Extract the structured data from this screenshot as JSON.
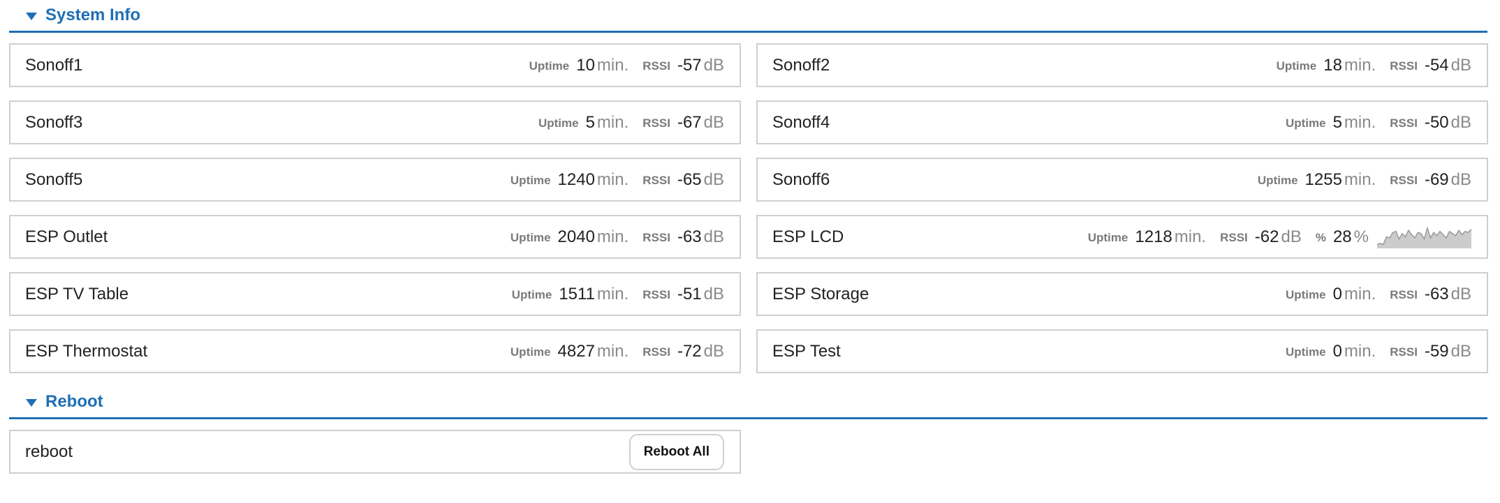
{
  "system_info": {
    "title": "System Info",
    "labels": {
      "uptime": "Uptime",
      "rssi": "RSSI",
      "percent": "%"
    },
    "units": {
      "uptime": "min.",
      "rssi": "dB",
      "percent": "%"
    },
    "devices": [
      {
        "name": "Sonoff1",
        "uptime": "10",
        "rssi": "-57"
      },
      {
        "name": "Sonoff2",
        "uptime": "18",
        "rssi": "-54"
      },
      {
        "name": "Sonoff3",
        "uptime": "5",
        "rssi": "-67"
      },
      {
        "name": "Sonoff4",
        "uptime": "5",
        "rssi": "-50"
      },
      {
        "name": "Sonoff5",
        "uptime": "1240",
        "rssi": "-65"
      },
      {
        "name": "Sonoff6",
        "uptime": "1255",
        "rssi": "-69"
      },
      {
        "name": "ESP Outlet",
        "uptime": "2040",
        "rssi": "-63"
      },
      {
        "name": "ESP LCD",
        "uptime": "1218",
        "rssi": "-62",
        "percent": "28",
        "sparkline": [
          3,
          4,
          3,
          10,
          9,
          14,
          15,
          8,
          13,
          10,
          16,
          12,
          9,
          14,
          13,
          8,
          18,
          9,
          14,
          11,
          15,
          12,
          9,
          15,
          13,
          11,
          16,
          12,
          15,
          14,
          17
        ]
      },
      {
        "name": "ESP TV Table",
        "uptime": "1511",
        "rssi": "-51"
      },
      {
        "name": "ESP Storage",
        "uptime": "0",
        "rssi": "-63"
      },
      {
        "name": "ESP Thermostat",
        "uptime": "4827",
        "rssi": "-72"
      },
      {
        "name": "ESP Test",
        "uptime": "0",
        "rssi": "-59"
      }
    ]
  },
  "reboot": {
    "title": "Reboot",
    "row_label": "reboot",
    "button_label": "Reboot All"
  },
  "colors": {
    "accent": "#1f6fb5",
    "border": "#cfcfcf",
    "sparkline_fill": "#cccccc"
  }
}
